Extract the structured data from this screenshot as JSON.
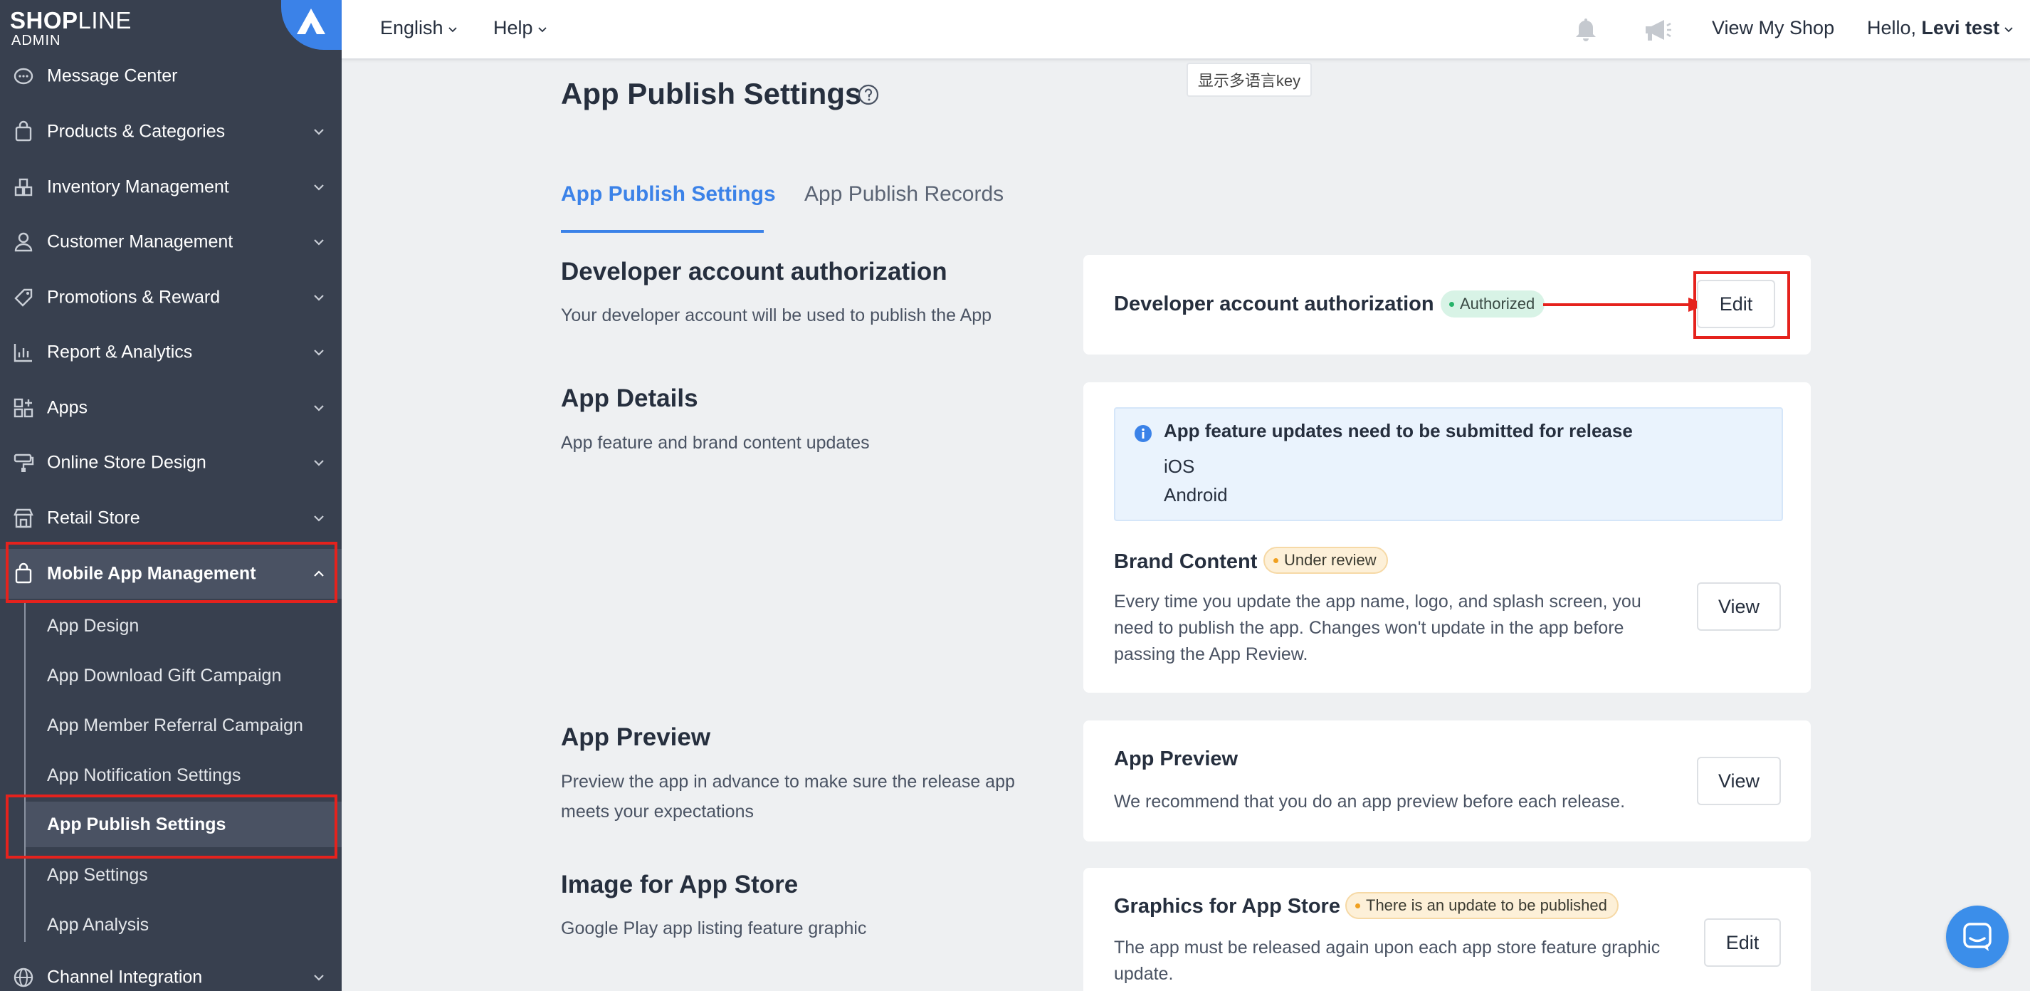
{
  "brand": {
    "name_bold": "SHOP",
    "name_thin": "LINE",
    "sub": "ADMIN"
  },
  "header": {
    "language": "English",
    "help": "Help",
    "view_shop": "View My Shop",
    "greeting_prefix": "Hello, ",
    "user_name": "Levi test"
  },
  "lang_key_tooltip": "显示多语言key",
  "sidebar": {
    "items": [
      {
        "label": "Message Center",
        "icon": "message-icon"
      },
      {
        "label": "Products & Categories",
        "icon": "bag-icon"
      },
      {
        "label": "Inventory Management",
        "icon": "boxes-icon"
      },
      {
        "label": "Customer Management",
        "icon": "person-icon"
      },
      {
        "label": "Promotions & Reward",
        "icon": "tag-icon"
      },
      {
        "label": "Report & Analytics",
        "icon": "chart-icon"
      },
      {
        "label": "Apps",
        "icon": "apps-icon"
      },
      {
        "label": "Online Store Design",
        "icon": "brush-icon"
      },
      {
        "label": "Retail Store",
        "icon": "store-icon"
      },
      {
        "label": "Mobile App Management",
        "icon": "bag-icon"
      },
      {
        "label": "Channel Integration",
        "icon": "globe-icon"
      }
    ],
    "sub_items": [
      {
        "label": "App Design"
      },
      {
        "label": "App Download Gift Campaign"
      },
      {
        "label": "App Member Referral Campaign"
      },
      {
        "label": "App Notification Settings"
      },
      {
        "label": "App Publish Settings"
      },
      {
        "label": "App Settings"
      },
      {
        "label": "App Analysis"
      }
    ]
  },
  "page": {
    "title": "App Publish Settings",
    "tabs": [
      {
        "label": "App Publish Settings",
        "active": true
      },
      {
        "label": "App Publish Records",
        "active": false
      }
    ]
  },
  "sections": {
    "developer": {
      "title": "Developer account authorization",
      "desc": "Your developer account will be used to publish the App",
      "card_title": "Developer account authorization",
      "badge": "Authorized",
      "button": "Edit"
    },
    "details": {
      "title": "App Details",
      "desc": "App feature and brand content updates",
      "info_title": "App feature updates need to be submitted for release",
      "info_items": [
        "iOS",
        "Android"
      ],
      "brand_title": "Brand Content",
      "brand_badge": "Under review",
      "brand_text": "Every time you update the app name, logo, and splash screen, you need to publish the app. Changes won't update in the app before passing the App Review.",
      "button": "View"
    },
    "preview": {
      "title": "App Preview",
      "desc": "Preview the app in advance to make sure the release app meets your expectations",
      "card_title": "App Preview",
      "card_text": "We recommend that you do an app preview before each release.",
      "button": "View"
    },
    "image": {
      "title": "Image for App Store",
      "desc": "Google Play app listing feature graphic",
      "card_title": "Graphics for App Store",
      "badge": "There is an update to be published",
      "card_text": "The app must be released again upon each app store feature graphic update.",
      "button": "Edit"
    }
  },
  "colors": {
    "sidebar_bg": "#38404f",
    "accent": "#3b82e8",
    "highlight_red": "#e5221d",
    "success": "#27b36a",
    "warning": "#f0a020"
  }
}
